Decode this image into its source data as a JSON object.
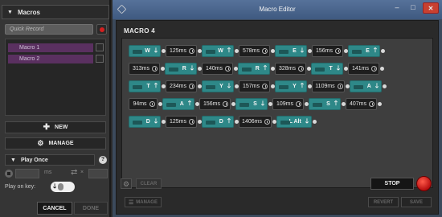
{
  "left_panel": {
    "macros_header": "Macros",
    "quick_record_placeholder": "Quick Record",
    "macros": [
      "Macro 1",
      "Macro 2"
    ],
    "new_label": "NEW",
    "manage_label": "MANAGE",
    "play_mode": "Play Once",
    "help": "?",
    "ms_label": "ms",
    "times_label": "×",
    "play_on_key_label": "Play on key:",
    "cancel_label": "CANCEL",
    "done_label": "DONE"
  },
  "window": {
    "title": "Macro Editor",
    "minimize": "–",
    "maximize": "□",
    "close": "✕"
  },
  "editor": {
    "macro_name": "MACRO 4",
    "clear_label": "CLEAR",
    "stop_label": "STOP",
    "manage_label": "MANAGE",
    "revert_label": "REVERT",
    "save_label": "SAVE"
  },
  "events": [
    [
      {
        "type": "key",
        "key": "W",
        "dir": "down"
      },
      {
        "type": "delay",
        "ms": "125"
      },
      {
        "type": "key",
        "key": "W",
        "dir": "up"
      },
      {
        "type": "delay",
        "ms": "578"
      },
      {
        "type": "key",
        "key": "E",
        "dir": "down"
      },
      {
        "type": "delay",
        "ms": "156"
      },
      {
        "type": "key",
        "key": "E",
        "dir": "up"
      }
    ],
    [
      {
        "type": "delay",
        "ms": "313"
      },
      {
        "type": "key",
        "key": "R",
        "dir": "down"
      },
      {
        "type": "delay",
        "ms": "140"
      },
      {
        "type": "key",
        "key": "R",
        "dir": "up"
      },
      {
        "type": "delay",
        "ms": "328"
      },
      {
        "type": "key",
        "key": "T",
        "dir": "down"
      },
      {
        "type": "delay",
        "ms": "141"
      }
    ],
    [
      {
        "type": "key",
        "key": "T",
        "dir": "up"
      },
      {
        "type": "delay",
        "ms": "234"
      },
      {
        "type": "key",
        "key": "Y",
        "dir": "down"
      },
      {
        "type": "delay",
        "ms": "157"
      },
      {
        "type": "key",
        "key": "Y",
        "dir": "up"
      },
      {
        "type": "delay",
        "ms": "1109"
      },
      {
        "type": "key",
        "key": "A",
        "dir": "down"
      }
    ],
    [
      {
        "type": "delay",
        "ms": "94"
      },
      {
        "type": "key",
        "key": "A",
        "dir": "up"
      },
      {
        "type": "delay",
        "ms": "156"
      },
      {
        "type": "key",
        "key": "S",
        "dir": "down"
      },
      {
        "type": "delay",
        "ms": "109"
      },
      {
        "type": "key",
        "key": "S",
        "dir": "up"
      },
      {
        "type": "delay",
        "ms": "407"
      }
    ],
    [
      {
        "type": "key",
        "key": "D",
        "dir": "down"
      },
      {
        "type": "delay",
        "ms": "125"
      },
      {
        "type": "key",
        "key": "D",
        "dir": "up"
      },
      {
        "type": "delay",
        "ms": "1406"
      },
      {
        "type": "key",
        "key": "L Alt",
        "dir": "down"
      }
    ]
  ],
  "colors": {
    "key_event": "#2e8888",
    "delay_event": "#1e1e1e",
    "macro_item": "#5a3060",
    "record_red": "#d42020",
    "title_bar": "#4a6890"
  },
  "icons": {
    "record": "record-icon",
    "new": "plus-icon",
    "manage": "gear-icon",
    "pause": "pause-icon",
    "loop": "loop-icon",
    "delay": "clock-icon",
    "key_down": "arrow-down-icon",
    "key_up": "arrow-up-icon"
  }
}
